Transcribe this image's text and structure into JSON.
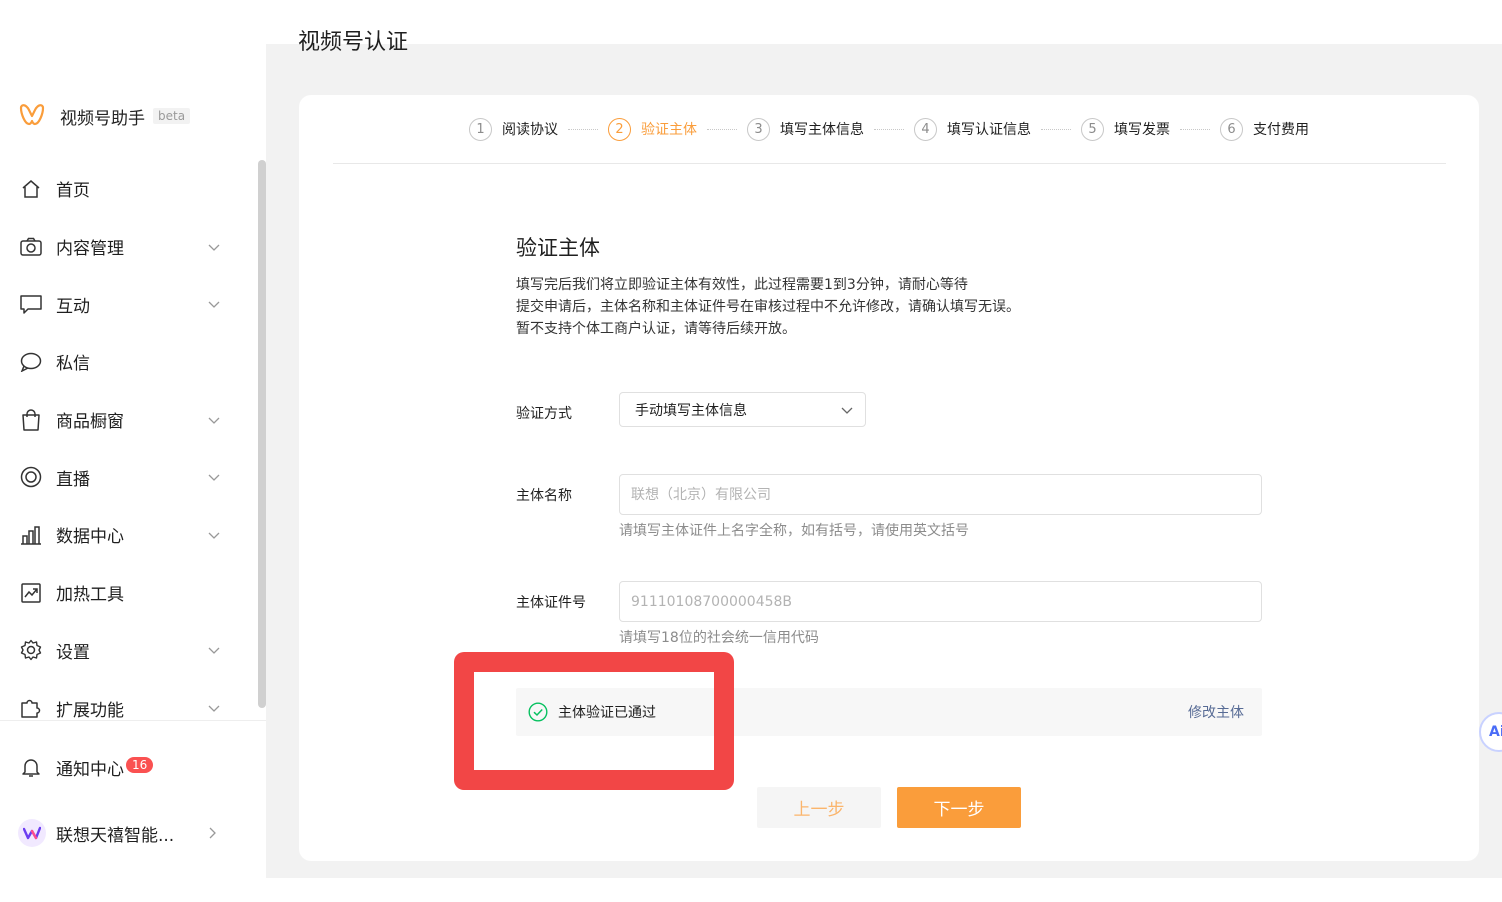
{
  "brand": {
    "name": "视频号助手",
    "beta": "beta"
  },
  "sidebar": {
    "items": [
      {
        "label": "首页",
        "icon": "home-icon",
        "has_children": false
      },
      {
        "label": "内容管理",
        "icon": "camera-icon",
        "has_children": true
      },
      {
        "label": "互动",
        "icon": "comment-icon",
        "has_children": true
      },
      {
        "label": "私信",
        "icon": "message-icon",
        "has_children": false
      },
      {
        "label": "商品橱窗",
        "icon": "shopping-bag-icon",
        "has_children": true
      },
      {
        "label": "直播",
        "icon": "live-icon",
        "has_children": true
      },
      {
        "label": "数据中心",
        "icon": "bar-chart-icon",
        "has_children": true
      },
      {
        "label": "加热工具",
        "icon": "trend-icon",
        "has_children": false
      },
      {
        "label": "设置",
        "icon": "gear-icon",
        "has_children": true
      },
      {
        "label": "扩展功能",
        "icon": "puzzle-icon",
        "has_children": true
      }
    ],
    "notification": {
      "label": "通知中心",
      "count": "16"
    },
    "account": {
      "name": "联想天禧智能..."
    }
  },
  "page": {
    "title": "视频号认证"
  },
  "steps": [
    {
      "num": "1",
      "label": "阅读协议",
      "active": false
    },
    {
      "num": "2",
      "label": "验证主体",
      "active": true
    },
    {
      "num": "3",
      "label": "填写主体信息",
      "active": false
    },
    {
      "num": "4",
      "label": "填写认证信息",
      "active": false
    },
    {
      "num": "5",
      "label": "填写发票",
      "active": false
    },
    {
      "num": "6",
      "label": "支付费用",
      "active": false
    }
  ],
  "section": {
    "title": "验证主体",
    "desc_lines": [
      "填写完后我们将立即验证主体有效性，此过程需要1到3分钟，请耐心等待",
      "提交申请后，主体名称和主体证件号在审核过程中不允许修改，请确认填写无误。",
      "暂不支持个体工商户认证，请等待后续开放。"
    ]
  },
  "form": {
    "method": {
      "label": "验证方式",
      "value": "手动填写主体信息"
    },
    "name": {
      "label": "主体名称",
      "placeholder": "联想（北京）有限公司",
      "hint": "请填写主体证件上名字全称，如有括号，请使用英文括号"
    },
    "id": {
      "label": "主体证件号",
      "placeholder": "91110108700000458B",
      "hint": "请填写18位的社会统一信用代码"
    }
  },
  "verify": {
    "status": "主体验证已通过",
    "modify": "修改主体"
  },
  "buttons": {
    "prev": "上一步",
    "next": "下一步"
  },
  "ai_fab": {
    "label": "Ai"
  },
  "colors": {
    "accent": "#fa9d3b",
    "success": "#07c160",
    "link": "#576b95",
    "highlight": "#f24646",
    "badge": "#fa5151"
  }
}
